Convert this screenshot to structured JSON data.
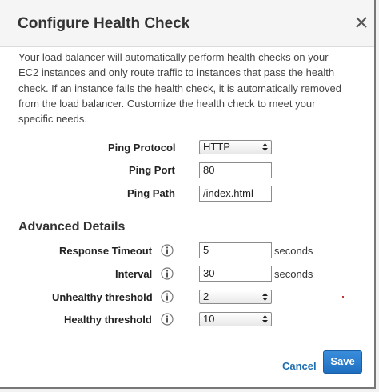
{
  "dialog": {
    "title": "Configure Health Check",
    "description": "Your load balancer will automatically perform health checks on your EC2 instances and only route traffic to instances that pass the health check. If an instance fails the health check, it is automatically removed from the load balancer. Customize the health check to meet your specific needs."
  },
  "ping": {
    "protocol_label": "Ping Protocol",
    "protocol_value": "HTTP",
    "port_label": "Ping Port",
    "port_value": "80",
    "path_label": "Ping Path",
    "path_value": "/index.html"
  },
  "advanced": {
    "title": "Advanced Details",
    "response_timeout_label": "Response Timeout",
    "response_timeout_value": "5",
    "response_timeout_unit": "seconds",
    "interval_label": "Interval",
    "interval_value": "30",
    "interval_unit": "seconds",
    "unhealthy_label": "Unhealthy threshold",
    "unhealthy_value": "2",
    "healthy_label": "Healthy threshold",
    "healthy_value": "10"
  },
  "footer": {
    "cancel_label": "Cancel",
    "save_label": "Save"
  },
  "colors": {
    "link": "#1f6fb2",
    "primary_button": "#2a7fd0"
  },
  "icons": [
    "close-icon",
    "info-icon",
    "select-caret-icon"
  ]
}
